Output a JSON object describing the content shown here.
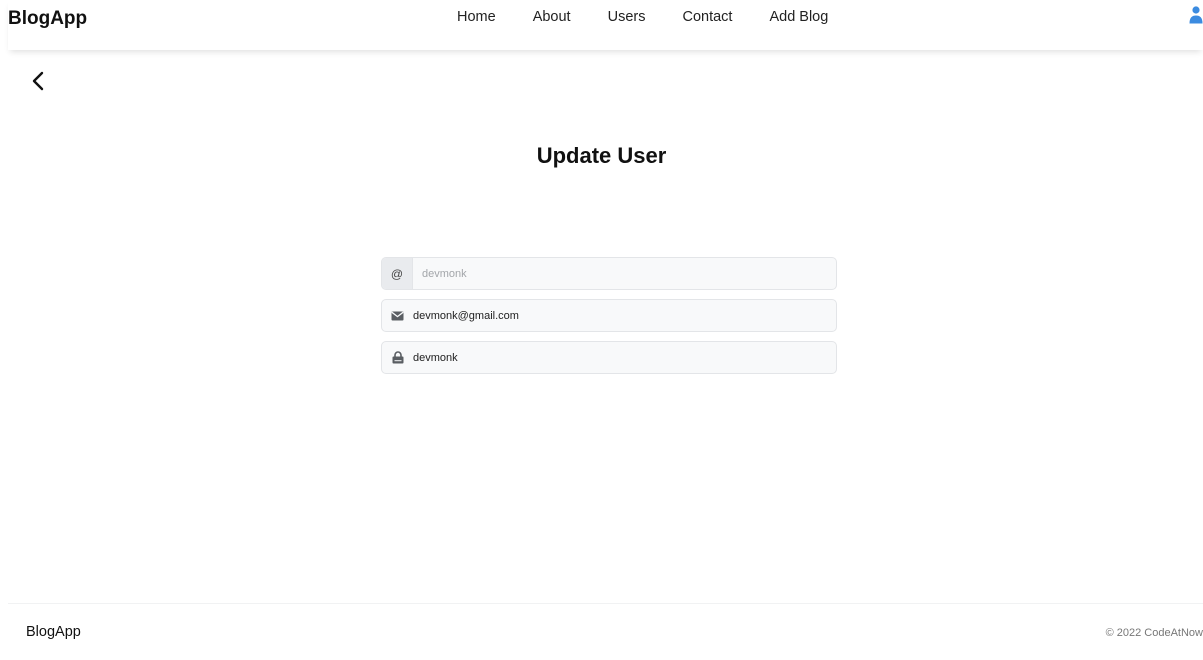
{
  "header": {
    "brand": "BlogApp",
    "nav": [
      "Home",
      "About",
      "Users",
      "Contact",
      "Add Blog"
    ],
    "user_icon": "user-icon",
    "accent_color": "#3b8be0"
  },
  "back": {
    "icon": "chevron-left-icon"
  },
  "main": {
    "title": "Update User",
    "form": {
      "username": {
        "prefix": "@",
        "value": "",
        "placeholder": "devmonk"
      },
      "email": {
        "icon": "envelope-icon",
        "value": "devmonk@gmail.com",
        "placeholder": ""
      },
      "password": {
        "icon": "lock-icon",
        "value": "devmonk",
        "placeholder": ""
      }
    }
  },
  "footer": {
    "brand": "BlogApp",
    "copyright": "© 2022 CodeAtNow"
  }
}
